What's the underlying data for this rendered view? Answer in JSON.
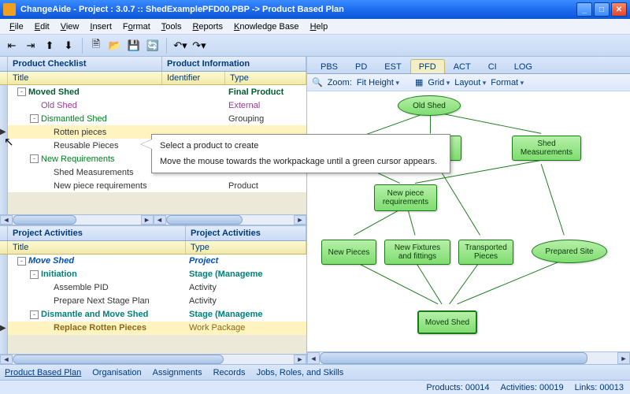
{
  "window": {
    "title": "ChangeAide - Project : 3.0.7  :: ShedExamplePFD00.PBP -> Product Based Plan"
  },
  "menu": [
    "File",
    "Edit",
    "View",
    "Insert",
    "Format",
    "Tools",
    "Reports",
    "Knowledge Base",
    "Help"
  ],
  "panes": {
    "checklist": {
      "header1": "Product Checklist",
      "header2": "Product Information",
      "sub1": "Title",
      "sub2": "Identifier",
      "sub3": "Type",
      "rows": [
        {
          "indent": 0,
          "exp": "-",
          "title": "Moved Shed",
          "t": "c-title",
          "type": "Final Product",
          "tt": "c-title"
        },
        {
          "indent": 1,
          "title": "Old Shed",
          "t": "c-purple",
          "type": "External",
          "tt": "c-purple"
        },
        {
          "indent": 1,
          "exp": "-",
          "title": "Dismantled Shed",
          "t": "c-green",
          "type": "Grouping",
          "tt": "c-plain"
        },
        {
          "indent": 2,
          "title": "Rotten pieces",
          "t": "c-plain",
          "sel": true
        },
        {
          "indent": 2,
          "title": "Reusable Pieces",
          "t": "c-plain"
        },
        {
          "indent": 1,
          "exp": "-",
          "title": "New Requirements",
          "t": "c-green"
        },
        {
          "indent": 2,
          "title": "Shed Measurements",
          "t": "c-plain"
        },
        {
          "indent": 2,
          "title": "New piece requirements",
          "t": "c-plain",
          "type": "Product",
          "tt": "c-plain"
        }
      ]
    },
    "activities": {
      "header1": "Project Activities",
      "header2": "Project Activities",
      "sub1": "Title",
      "sub2": "Type",
      "rows": [
        {
          "indent": 0,
          "exp": "-",
          "title": "Move Shed",
          "t": "c-bluei",
          "type": "Project",
          "tt": "c-bluei"
        },
        {
          "indent": 1,
          "exp": "-",
          "title": "Initiation",
          "t": "c-teal",
          "type": "Stage (Manageme",
          "tt": "c-teal"
        },
        {
          "indent": 2,
          "title": "Assemble PID",
          "t": "c-plain",
          "type": "Activity",
          "tt": "c-plain"
        },
        {
          "indent": 2,
          "title": "Prepare Next Stage Plan",
          "t": "c-plain",
          "type": "Activity",
          "tt": "c-plain"
        },
        {
          "indent": 1,
          "exp": "-",
          "title": "Dismantle and Move Shed",
          "t": "c-teal",
          "type": "Stage (Manageme",
          "tt": "c-teal"
        },
        {
          "indent": 2,
          "title": "Replace Rotten Pieces",
          "t": "c-brown",
          "type": "Work Package",
          "tt": "c-brownr",
          "sel": true
        }
      ]
    }
  },
  "tabs": [
    "PBS",
    "PD",
    "EST",
    "PFD",
    "ACT",
    "CI",
    "LOG"
  ],
  "activeTab": "PFD",
  "diagtool": {
    "zoom_label": "Zoom:",
    "zoom_value": "Fit Height",
    "grid": "Grid",
    "layout": "Layout",
    "format": "Format"
  },
  "nodes": {
    "old_shed": "Old Shed",
    "rotten": "Rotten pieces",
    "reusable": "Reusable Pieces",
    "shed_meas": "Shed Measurements",
    "new_req": "New piece requirements",
    "new_pieces": "New Pieces",
    "fixtures": "New Fixtures and fittings",
    "transported": "Transported Pieces",
    "prepared": "Prepared Site",
    "moved": "Moved Shed"
  },
  "tooltip": {
    "line1": "Select a product to create",
    "line2": "Move the mouse towards the workpackage until a green cursor appears."
  },
  "bottomtabs": [
    "Product Based Plan",
    "Organisation",
    "Assignments",
    "Records",
    "Jobs, Roles, and Skills"
  ],
  "status": {
    "products": "Products: 00014",
    "activities": "Activities: 00019",
    "links": "Links: 00013"
  }
}
